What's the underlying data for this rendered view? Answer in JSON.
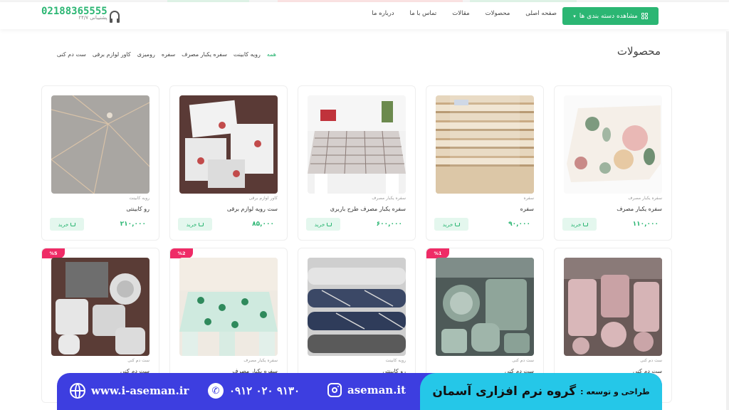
{
  "header": {
    "categories_button": "مشاهده دسته بندی ها",
    "nav": [
      "صفحه اصلی",
      "محصولات",
      "مقالات",
      "تماس با ما",
      "درباره ما"
    ],
    "phone": "02188365555",
    "support": "پشتیبانی ۲۴/۷"
  },
  "page_title": "محصولات",
  "filters": [
    "همه",
    "رویه کابینت",
    "سفره یکبار مصرف",
    "سفره",
    "رومیزی",
    "کاور لوازم برقی",
    "ست دم کنی"
  ],
  "buy_label": "خرید",
  "products": [
    {
      "name": "سفره یکبار مصرف",
      "category": "سفره یکبار مصرف",
      "price": "۱۱۰,۰۰۰",
      "badge": ""
    },
    {
      "name": "سفره",
      "category": "سفره",
      "price": "۹۰,۰۰۰",
      "badge": ""
    },
    {
      "name": "سفره یکبار مصرف طرح باربری",
      "category": "سفره یکبار مصرف",
      "price": "۶۰۰,۰۰۰",
      "badge": ""
    },
    {
      "name": "ست رویه لوازم برقی",
      "category": "کاور لوازم برقی",
      "price": "۸۵,۰۰۰",
      "badge": ""
    },
    {
      "name": "رو کابینتی",
      "category": "رویه کابینت",
      "price": "۲۱۰,۰۰۰",
      "badge": ""
    },
    {
      "name": "ست دم کنی",
      "category": "ست دم کنی",
      "price": "",
      "badge": ""
    },
    {
      "name": "ست دم کنی",
      "category": "ست دم کنی",
      "price": "",
      "badge": "%1"
    },
    {
      "name": "رو کابینتی",
      "category": "رویه کابینت",
      "price": "",
      "badge": ""
    },
    {
      "name": "سفره یکبار مصرف",
      "category": "سفره یکبار مصرف",
      "price": "",
      "badge": "%2"
    },
    {
      "name": "ست دم کنی",
      "category": "ست دم کنی",
      "price": "",
      "badge": "%5"
    }
  ],
  "banner": {
    "label": "طراحی و توسعه :",
    "team": "گروه نرم افزاری آسمان",
    "instagram": "aseman.it",
    "phone": "۰۹۱۲ ۰۲۰ ۹۱۳۰",
    "website": "www.i-aseman.ir"
  },
  "colors": {
    "accent": "#2bb673",
    "badge": "#ef2b66",
    "banner_blue": "#3d3ee0",
    "banner_cyan": "#25c7e8"
  }
}
